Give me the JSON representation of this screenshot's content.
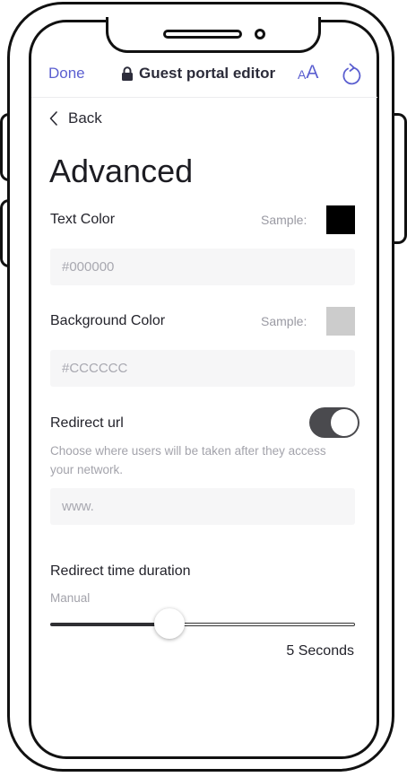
{
  "header": {
    "done_label": "Done",
    "title": "Guest portal editor",
    "text_size_small": "A",
    "text_size_large": "A",
    "accent_color": "#5b5fd0"
  },
  "nav": {
    "back_label": "Back"
  },
  "page": {
    "title": "Advanced"
  },
  "text_color": {
    "label": "Text Color",
    "sample_label": "Sample:",
    "sample_color": "#000000",
    "placeholder": "#000000"
  },
  "background_color": {
    "label": "Background Color",
    "sample_label": "Sample:",
    "sample_color": "#CCCCCC",
    "placeholder": "#CCCCCC"
  },
  "redirect": {
    "label": "Redirect url",
    "enabled": true,
    "help_text": "Choose where users will be taken after they access your network.",
    "placeholder": "www."
  },
  "redirect_duration": {
    "label": "Redirect time duration",
    "min_label": "Manual",
    "value_fraction": 0.39,
    "value_label": "5 Seconds"
  }
}
